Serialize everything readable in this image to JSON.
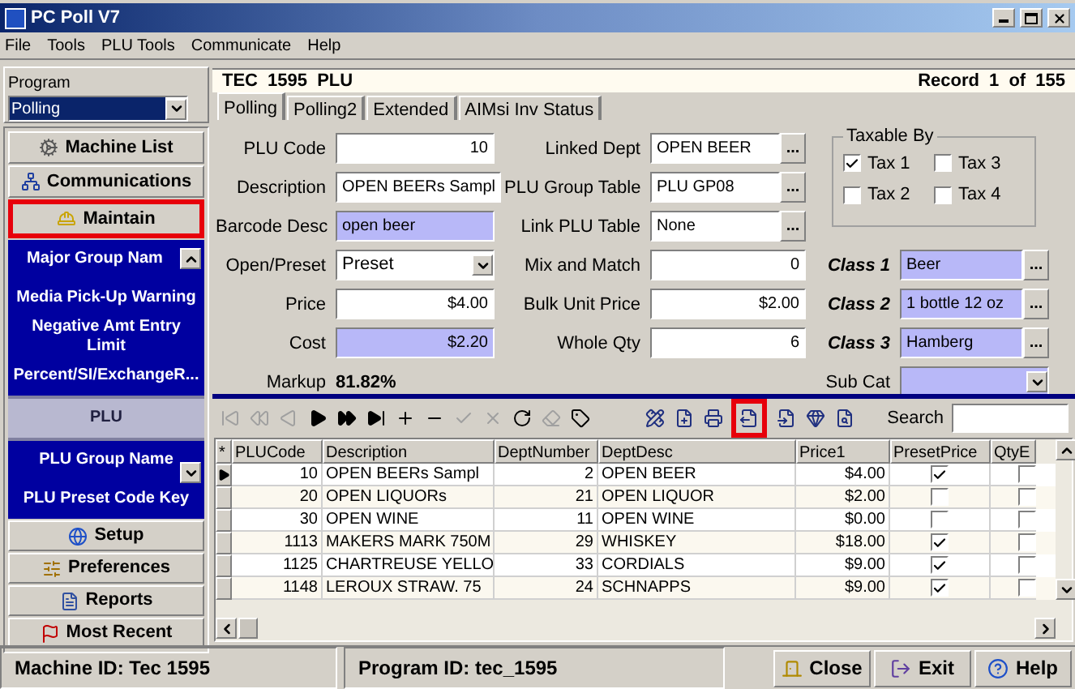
{
  "window": {
    "title": "PC Poll V7"
  },
  "menu": [
    "File",
    "Tools",
    "PLU Tools",
    "Communicate",
    "Help"
  ],
  "program": {
    "label": "Program",
    "value": "Polling"
  },
  "nav_top": [
    {
      "label": "Machine List",
      "highlighted": false
    },
    {
      "label": "Communications",
      "highlighted": false
    },
    {
      "label": "Maintain",
      "highlighted": true
    }
  ],
  "maintain_list": [
    {
      "label": "Major Group Nam",
      "selected": false
    },
    {
      "label": "Media Pick-Up Warning",
      "selected": false
    },
    {
      "label": "Negative Amt Entry Limit",
      "selected": false
    },
    {
      "label": "Percent/SI/ExchangeR...",
      "selected": false
    },
    {
      "label": "PLU",
      "selected": true
    },
    {
      "label": "PLU Group Name",
      "selected": false
    },
    {
      "label": "PLU Preset Code Key",
      "selected": false
    }
  ],
  "nav_bottom": [
    {
      "label": "Setup"
    },
    {
      "label": "Preferences"
    },
    {
      "label": "Reports"
    },
    {
      "label": "Most Recent"
    }
  ],
  "header": {
    "title": "TEC 1595 PLU",
    "record": "Record 1 of 155"
  },
  "tabs": [
    {
      "label": "Polling",
      "selected": true
    },
    {
      "label": "Polling2",
      "selected": false
    },
    {
      "label": "Extended",
      "selected": false
    },
    {
      "label": "AIMsi Inv Status",
      "selected": false
    }
  ],
  "form": {
    "plu_code": {
      "label": "PLU Code",
      "value": "10"
    },
    "description": {
      "label": "Description",
      "value": "OPEN BEERs Sampl"
    },
    "barcode_desc": {
      "label": "Barcode Desc",
      "value": "open beer"
    },
    "open_preset": {
      "label": "Open/Preset",
      "value": "Preset"
    },
    "price": {
      "label": "Price",
      "value": "$4.00"
    },
    "cost": {
      "label": "Cost",
      "value": "$2.20"
    },
    "markup": {
      "label": "Markup",
      "value": "81.82%"
    },
    "linked_dept": {
      "label": "Linked Dept",
      "value": "OPEN BEER",
      "button": "..."
    },
    "plu_group_table": {
      "label": "PLU Group Table",
      "value": "PLU GP08",
      "button": "..."
    },
    "link_plu_table": {
      "label": "Link PLU Table",
      "value": "None",
      "button": "..."
    },
    "mix_and_match": {
      "label": "Mix and Match",
      "value": "0"
    },
    "bulk_unit_price": {
      "label": "Bulk Unit Price",
      "value": "$2.00"
    },
    "whole_qty": {
      "label": "Whole Qty",
      "value": "6"
    },
    "taxable_by": {
      "label": "Taxable By",
      "taxes": [
        {
          "label": "Tax 1",
          "checked": true
        },
        {
          "label": "Tax 3",
          "checked": false
        },
        {
          "label": "Tax 2",
          "checked": false
        },
        {
          "label": "Tax 4",
          "checked": false
        }
      ]
    },
    "classes": [
      {
        "label": "Class 1",
        "value": "Beer",
        "button": "..."
      },
      {
        "label": "Class 2",
        "value": "1 bottle 12 oz",
        "button": "..."
      },
      {
        "label": "Class 3",
        "value": "Hamberg",
        "button": "..."
      }
    ],
    "sub_cat": {
      "label": "Sub Cat"
    }
  },
  "tools": [
    {
      "disabled": true,
      "highlighted": false
    },
    {
      "disabled": true,
      "highlighted": false
    },
    {
      "disabled": true,
      "highlighted": false
    },
    {
      "disabled": false,
      "highlighted": false
    },
    {
      "disabled": false,
      "highlighted": false
    },
    {
      "disabled": false,
      "highlighted": false
    },
    {
      "disabled": false,
      "highlighted": false
    },
    {
      "disabled": false,
      "highlighted": false
    },
    {
      "disabled": true,
      "highlighted": false
    },
    {
      "disabled": true,
      "highlighted": false
    },
    {
      "disabled": false,
      "highlighted": false
    },
    {
      "disabled": true,
      "highlighted": false
    },
    {
      "disabled": false,
      "highlighted": false
    },
    {
      "disabled": false,
      "highlighted": false
    },
    {
      "disabled": false,
      "highlighted": false
    },
    {
      "disabled": false,
      "highlighted": false
    },
    {
      "disabled": false,
      "highlighted": true
    },
    {
      "disabled": false,
      "highlighted": false
    },
    {
      "disabled": false,
      "highlighted": false
    },
    {
      "disabled": false,
      "highlighted": false
    }
  ],
  "search": {
    "label": "Search"
  },
  "table": {
    "columns": [
      "*",
      "PLUCode",
      "Description",
      "DeptNumber",
      "DeptDesc",
      "Price1",
      "PresetPrice",
      "QtyE"
    ],
    "rows": [
      {
        "current": true,
        "plu_code": "10",
        "description": "OPEN BEERs Sampl",
        "dept_number": "2",
        "dept_desc": "OPEN BEER",
        "price1": "$4.00",
        "preset_price": true,
        "qty": false
      },
      {
        "current": false,
        "plu_code": "20",
        "description": "OPEN LIQUORs",
        "dept_number": "21",
        "dept_desc": "OPEN LIQUOR",
        "price1": "$2.00",
        "preset_price": false,
        "qty": false
      },
      {
        "current": false,
        "plu_code": "30",
        "description": "OPEN WINE",
        "dept_number": "11",
        "dept_desc": "OPEN WINE",
        "price1": "$0.00",
        "preset_price": false,
        "qty": false
      },
      {
        "current": false,
        "plu_code": "1113",
        "description": "MAKERS MARK 750M",
        "dept_number": "29",
        "dept_desc": "WHISKEY",
        "price1": "$18.00",
        "preset_price": true,
        "qty": false
      },
      {
        "current": false,
        "plu_code": "1125",
        "description": "CHARTREUSE YELLO",
        "dept_number": "33",
        "dept_desc": "CORDIALS",
        "price1": "$9.00",
        "preset_price": true,
        "qty": false
      },
      {
        "current": false,
        "plu_code": "1148",
        "description": "LEROUX STRAW. 75",
        "dept_number": "24",
        "dept_desc": "SCHNAPPS",
        "price1": "$9.00",
        "preset_price": true,
        "qty": false
      }
    ]
  },
  "status_bar": {
    "machine_id": "Machine ID: Tec 1595",
    "program_id": "Program ID: tec_1595",
    "buttons": [
      "Close",
      "Exit",
      "Help"
    ]
  }
}
